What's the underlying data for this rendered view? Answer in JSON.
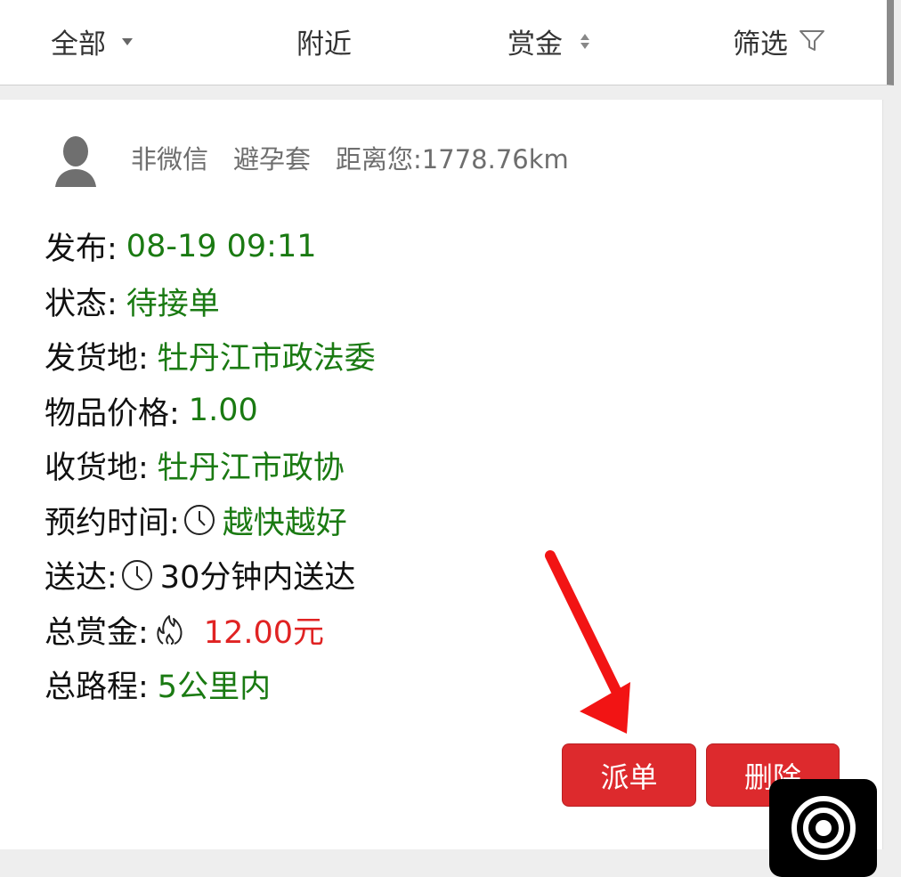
{
  "filter_bar": {
    "all_label": "全部",
    "nearby_label": "附近",
    "reward_label": "赏金",
    "filter_label": "筛选"
  },
  "order": {
    "user_type": "非微信",
    "item_name": "避孕套",
    "distance": "距离您:1778.76km",
    "fields": {
      "publish_label": "发布:",
      "publish_value": "08-19 09:11",
      "status_label": "状态:",
      "status_value": "待接单",
      "origin_label": "发货地:",
      "origin_value": "牡丹江市政法委",
      "price_label": "物品价格:",
      "price_value": "1.00",
      "dest_label": "收货地:",
      "dest_value": "牡丹江市政协",
      "appointment_label": "预约时间:",
      "appointment_value": "越快越好",
      "delivery_label": "送达:",
      "delivery_value": "30分钟内送达",
      "reward_label": "总赏金:",
      "reward_value": "12.00元",
      "route_label": "总路程:",
      "route_value": "5公里内"
    },
    "actions": {
      "dispatch_label": "派单",
      "delete_label": "删除"
    }
  },
  "icons": {
    "filter": "funnel-icon",
    "clock": "clock-icon",
    "fire": "fire-icon",
    "avatar": "default-avatar-icon",
    "arrow": "red-arrow-annotation",
    "floating": "record-target-icon"
  },
  "colors": {
    "accent_green": "#1a7a12",
    "accent_red": "#e02323",
    "button_red": "#dd2a2d",
    "meta_gray": "#6e6e6e"
  }
}
